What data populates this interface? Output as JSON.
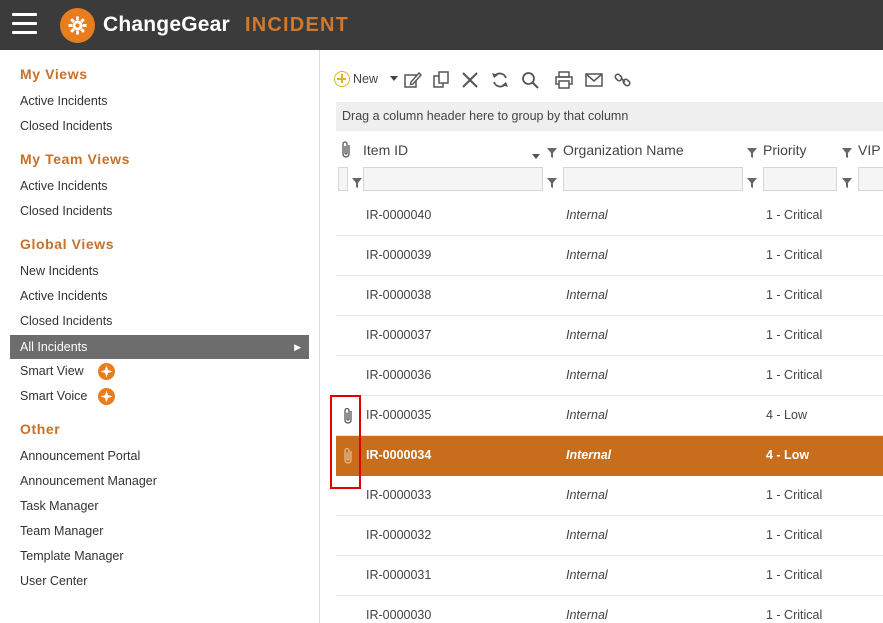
{
  "app": {
    "brand": "ChangeGear",
    "module": "INCIDENT"
  },
  "sidebar": {
    "sections": [
      {
        "title": "My Views",
        "items": [
          "Active Incidents",
          "Closed Incidents"
        ]
      },
      {
        "title": "My Team Views",
        "items": [
          "Active Incidents",
          "Closed Incidents"
        ]
      },
      {
        "title": "Global Views",
        "items": [
          "New Incidents",
          "Active Incidents",
          "Closed Incidents",
          "All Incidents",
          "Smart View",
          "Smart Voice"
        ]
      },
      {
        "title": "Other",
        "items": [
          "Announcement Portal",
          "Announcement Manager",
          "Task Manager",
          "Team Manager",
          "Template Manager",
          "User Center"
        ]
      }
    ],
    "active_item": "All Incidents"
  },
  "toolbar": {
    "new_label": "New"
  },
  "grid": {
    "group_hint": "Drag a column header here to group by that column",
    "columns": [
      "Item ID",
      "Organization Name",
      "Priority",
      "VIP"
    ],
    "rows": [
      {
        "id": "IR-0000040",
        "org": "Internal",
        "priority": "1 - Critical",
        "attachment": false
      },
      {
        "id": "IR-0000039",
        "org": "Internal",
        "priority": "1 - Critical",
        "attachment": false
      },
      {
        "id": "IR-0000038",
        "org": "Internal",
        "priority": "1 - Critical",
        "attachment": false
      },
      {
        "id": "IR-0000037",
        "org": "Internal",
        "priority": "1 - Critical",
        "attachment": false
      },
      {
        "id": "IR-0000036",
        "org": "Internal",
        "priority": "1 - Critical",
        "attachment": false
      },
      {
        "id": "IR-0000035",
        "org": "Internal",
        "priority": "4 - Low",
        "attachment": true
      },
      {
        "id": "IR-0000034",
        "org": "Internal",
        "priority": "4 - Low",
        "attachment": true,
        "selected": true
      },
      {
        "id": "IR-0000033",
        "org": "Internal",
        "priority": "1 - Critical",
        "attachment": false
      },
      {
        "id": "IR-0000032",
        "org": "Internal",
        "priority": "1 - Critical",
        "attachment": false
      },
      {
        "id": "IR-0000031",
        "org": "Internal",
        "priority": "1 - Critical",
        "attachment": false
      },
      {
        "id": "IR-0000030",
        "org": "Internal",
        "priority": "1 - Critical",
        "attachment": false
      }
    ]
  },
  "colors": {
    "topbar": "#3b3b3b",
    "accent": "#c86d1c",
    "brand_orange": "#e87d1e",
    "section_title": "#c8702a",
    "active_nav": "#6d6d6d",
    "highlight_box": "#e00000"
  }
}
